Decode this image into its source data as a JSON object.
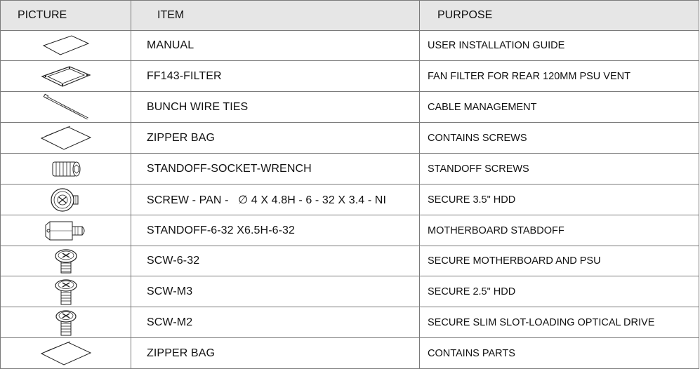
{
  "headers": {
    "picture": "PICTURE",
    "item": "ITEM",
    "purpose": "PURPOSE"
  },
  "rows": [
    {
      "icon": "manual-icon",
      "item": "MANUAL",
      "purpose": "USER INSTALLATION GUIDE"
    },
    {
      "icon": "fan-filter-icon",
      "item": "FF143-FILTER",
      "purpose": "FAN FILTER FOR REAR 120MM PSU VENT"
    },
    {
      "icon": "wire-tie-icon",
      "item": "BUNCH WIRE TIES",
      "purpose": "CABLE MANAGEMENT"
    },
    {
      "icon": "zipper-bag-icon",
      "item": "ZIPPER BAG",
      "purpose": "CONTAINS SCREWS"
    },
    {
      "icon": "socket-wrench-icon",
      "item": "STANDOFF-SOCKET-WRENCH",
      "purpose": "STANDOFF SCREWS"
    },
    {
      "icon": "thumb-screw-icon",
      "item_a": "SCREW - PAN -",
      "item_phi": "∅",
      "item_b": "4 X 4.8H - 6 - 32 X 3.4 - NI",
      "purpose": "SECURE 3.5\" HDD"
    },
    {
      "icon": "standoff-icon",
      "item": "STANDOFF-6-32 X6.5H-6-32",
      "purpose": "MOTHERBOARD STABDOFF"
    },
    {
      "icon": "screw-6-32-icon",
      "item": "SCW-6-32",
      "purpose": "SECURE MOTHERBOARD AND PSU"
    },
    {
      "icon": "screw-m3-icon",
      "item": "SCW-M3",
      "purpose": "SECURE 2.5\" HDD"
    },
    {
      "icon": "screw-m2-icon",
      "item": "SCW-M2",
      "purpose": "SECURE SLIM SLOT-LOADING OPTICAL DRIVE"
    },
    {
      "icon": "zipper-bag-icon",
      "item": "ZIPPER BAG",
      "purpose": "CONTAINS PARTS"
    }
  ]
}
